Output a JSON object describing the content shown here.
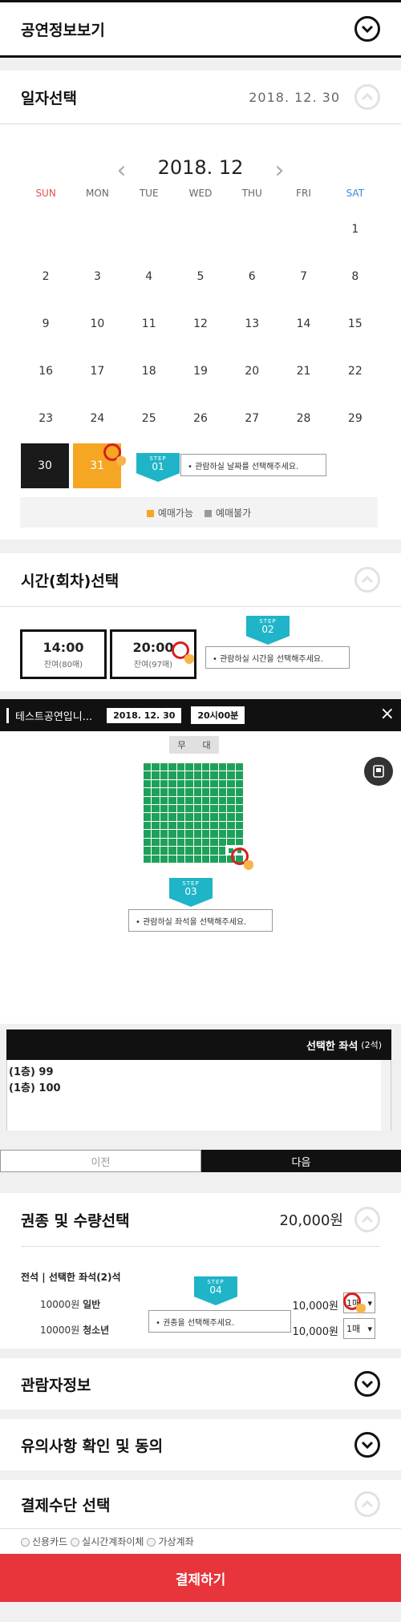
{
  "perf_info": {
    "title": "공연정보보기"
  },
  "date_select": {
    "title": "일자선택",
    "selected_date": "2018. 12. 30",
    "month": "2018. 12",
    "weekdays": [
      "SUN",
      "MON",
      "TUE",
      "WED",
      "THU",
      "FRI",
      "SAT"
    ],
    "weeks": [
      [
        "",
        "",
        "",
        "",
        "",
        "",
        "1"
      ],
      [
        "2",
        "3",
        "4",
        "5",
        "6",
        "7",
        "8"
      ],
      [
        "9",
        "10",
        "11",
        "12",
        "13",
        "14",
        "15"
      ],
      [
        "16",
        "17",
        "18",
        "19",
        "20",
        "21",
        "22"
      ],
      [
        "23",
        "24",
        "25",
        "26",
        "27",
        "28",
        "29"
      ]
    ],
    "day_30": "30",
    "day_31": "31",
    "step": {
      "label": "STEP",
      "num": "01"
    },
    "tip": "• 관람하실 날짜를 선택해주세요.",
    "legend_available": "예매가능",
    "legend_unavailable": "예매불가",
    "colors": {
      "selected": "#1a1a1a",
      "available": "#f5a623",
      "unavailable": "#999999"
    }
  },
  "time_select": {
    "title": "시간(회차)선택",
    "slots": [
      {
        "time": "14:00",
        "remain": "잔여(80매)"
      },
      {
        "time": "20:00",
        "remain": "잔여(97매)"
      }
    ],
    "step": {
      "label": "STEP",
      "num": "02"
    },
    "tip": "• 관람하실 시간을 선택해주세요."
  },
  "seat_popup": {
    "title": "테스트공연입니...",
    "date": "2018. 12. 30",
    "time": "20시00분",
    "close": "×",
    "stage_left": "무",
    "stage_right": "대",
    "step": {
      "label": "STEP",
      "num": "03"
    },
    "tip": "• 관람하실 좌석을 선택해주세요.",
    "selected_header": "선택한 좌석",
    "selected_count": "(2석)",
    "selected_seats": [
      "(1층) 99",
      "(1층) 100"
    ],
    "prev": "이전",
    "next": "다음",
    "seat_color": "#1fa05a"
  },
  "ticket": {
    "title": "권종 및 수량선택",
    "total": "20,000원",
    "subtitle": "전석 | 선택한 좌석(2)석",
    "rows": [
      {
        "price": "10000",
        "unit": "원",
        "type": "일반",
        "amount": "10,000원",
        "qty": "1매"
      },
      {
        "price": "10000",
        "unit": "원",
        "type": "청소년",
        "amount": "10,000원",
        "qty": "1매"
      }
    ],
    "step": {
      "label": "STEP",
      "num": "04"
    },
    "tip": "• 권종을 선택해주세요."
  },
  "viewer_info": {
    "title": "관람자정보"
  },
  "notice": {
    "title": "유의사항 확인 및 동의"
  },
  "payment": {
    "title": "결제수단 선택",
    "options": [
      "신용카드",
      "실시간계좌이체",
      "가상계좌"
    ],
    "pay_button": "결제하기",
    "pay_color": "#e8343b"
  }
}
